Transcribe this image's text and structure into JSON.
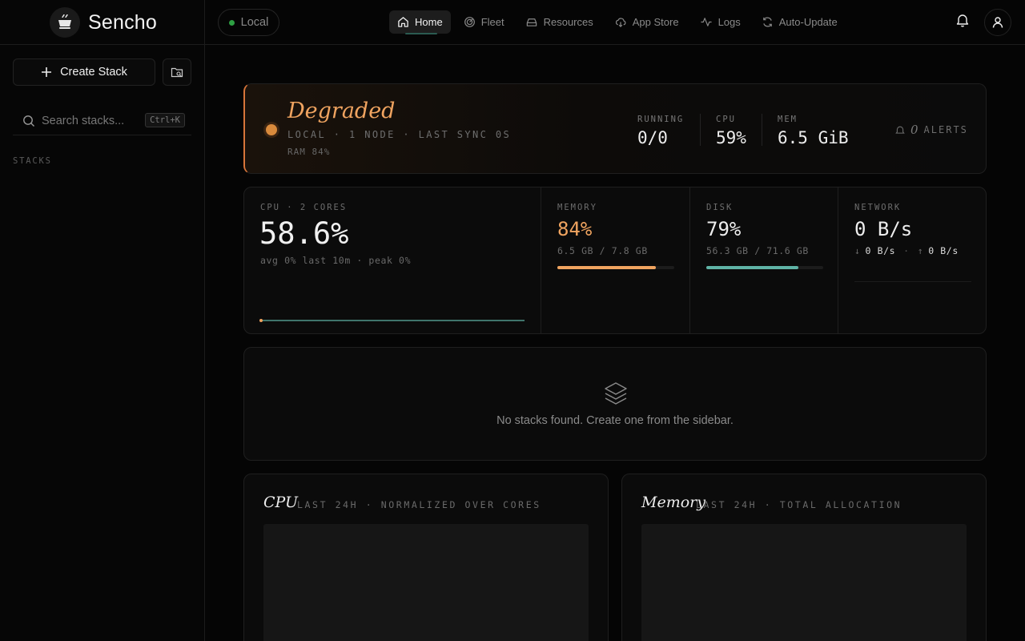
{
  "brand": {
    "name": "Sencho"
  },
  "sidebar": {
    "create_label": "Create Stack",
    "search_placeholder": "Search stacks...",
    "search_shortcut": "Ctrl+K",
    "stacks_label": "STACKS"
  },
  "topbar": {
    "env_label": "Local",
    "nav": [
      {
        "label": "Home",
        "icon": "home-icon",
        "active": true
      },
      {
        "label": "Fleet",
        "icon": "radar-icon"
      },
      {
        "label": "Resources",
        "icon": "drive-icon"
      },
      {
        "label": "App Store",
        "icon": "cloud-download-icon"
      },
      {
        "label": "Logs",
        "icon": "activity-icon"
      },
      {
        "label": "Auto-Update",
        "icon": "refresh-icon"
      }
    ]
  },
  "status": {
    "title": "Degraded",
    "subtitle": "LOCAL · 1 NODE · LAST SYNC 0S",
    "ram_note": "RAM 84%",
    "running_label": "RUNNING",
    "running_value": "0/0",
    "cpu_label": "CPU",
    "cpu_value": "59%",
    "mem_label": "MEM",
    "mem_value": "6.5 GiB",
    "alerts_count": "0",
    "alerts_label": "ALERTS",
    "accent": "#f0a460"
  },
  "metrics": {
    "cpu": {
      "label": "CPU · 2 CORES",
      "value": "58.6%",
      "sub": "avg 0% last 10m · peak 0%"
    },
    "memory": {
      "label": "MEMORY",
      "value": "84%",
      "sub": "6.5 GB / 7.8 GB",
      "fill": 0.84,
      "color": "#f0a460"
    },
    "disk": {
      "label": "DISK",
      "value": "79%",
      "sub": "56.3 GB / 71.6 GB",
      "fill": 0.79,
      "color": "#5fb3a6"
    },
    "network": {
      "label": "NETWORK",
      "value": "0 B/s",
      "down": "0 B/s",
      "up": "0 B/s"
    }
  },
  "empty": {
    "message": "No stacks found. Create one from the sidebar."
  },
  "charts": {
    "cpu": {
      "title": "CPU",
      "sub": "LAST 24H · NORMALIZED OVER CORES"
    },
    "memory": {
      "title": "Memory",
      "sub": "LAST 24H · TOTAL ALLOCATION"
    }
  }
}
